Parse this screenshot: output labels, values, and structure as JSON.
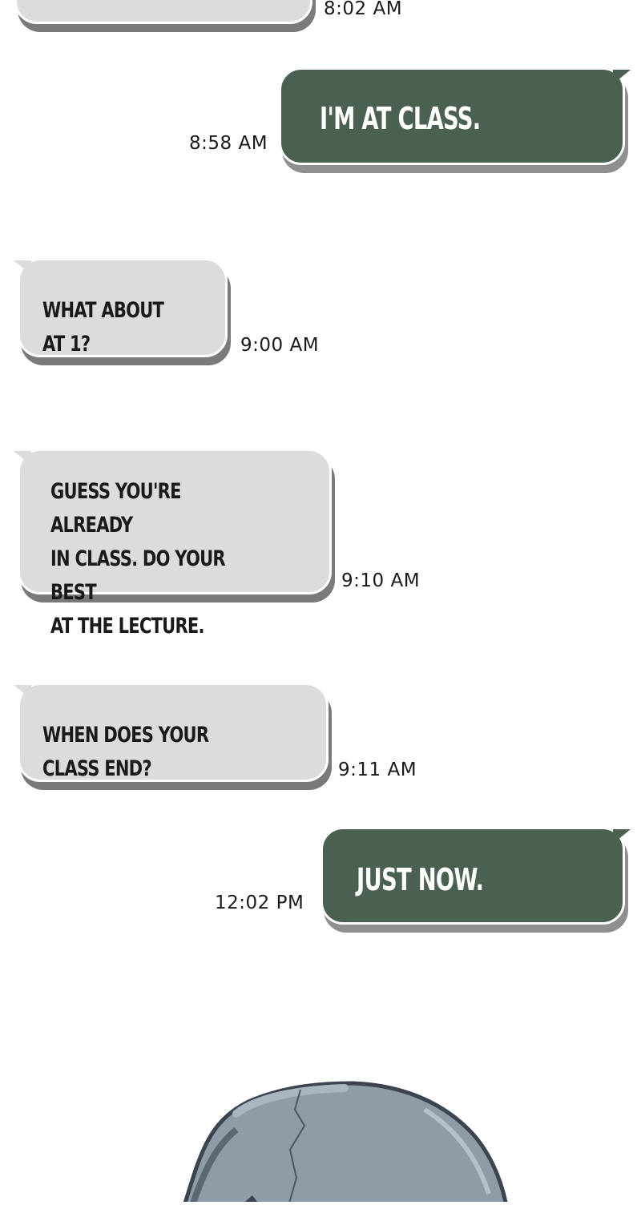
{
  "conversation": {
    "messages": [
      {
        "id": "m0",
        "direction": "incoming",
        "text": "",
        "time": "8:02 AM"
      },
      {
        "id": "m1",
        "direction": "outgoing",
        "text": "I'M AT CLASS.",
        "time": "8:58 AM"
      },
      {
        "id": "m2",
        "direction": "incoming",
        "text": "WHAT ABOUT AT 1?",
        "time": "9:00 AM"
      },
      {
        "id": "m3",
        "direction": "incoming",
        "text": "GUESS YOU'RE ALREADY\nIN CLASS. DO YOUR BEST\nAT THE LECTURE.",
        "time": "9:10 AM"
      },
      {
        "id": "m4",
        "direction": "incoming",
        "text": "WHEN DOES YOUR CLASS END?",
        "time": "9:11 AM"
      },
      {
        "id": "m5",
        "direction": "outgoing",
        "text": "JUST NOW.",
        "time": "12:02 PM"
      }
    ]
  },
  "colors": {
    "incoming_bubble": "#dcdcdc",
    "outgoing_bubble": "#4a6050",
    "rock": "#8e9ca8",
    "rock_outline": "#3b4450"
  },
  "illustration": {
    "icon": "rock-illustration"
  }
}
